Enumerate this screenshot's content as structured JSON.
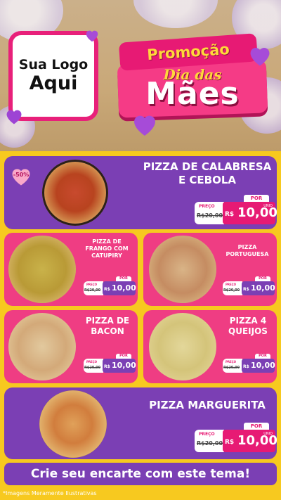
{
  "logo": {
    "line1": "Sua Logo",
    "line2": "Aqui"
  },
  "banner": {
    "line1": "Promoção",
    "line2": "Dia das",
    "line3": "Mães"
  },
  "badge": "-50%",
  "labels": {
    "price": "PREÇO",
    "por": "POR",
    "unit": "UNID"
  },
  "products": [
    {
      "name_lines": [
        "PIZZA DE CALABRESA",
        "E CEBOLA"
      ],
      "old_price": "R$20,00",
      "currency": "R$",
      "price": "10,00"
    },
    {
      "name_lines": [
        "PIZZA DE",
        "FRANGO COM",
        "CATUPIRY"
      ],
      "old_price": "R$20,00",
      "currency": "R$",
      "price": "10,00"
    },
    {
      "name_lines": [
        "PIZZA",
        "PORTUGUESA"
      ],
      "old_price": "R$20,00",
      "currency": "R$",
      "price": "10,00"
    },
    {
      "name_lines": [
        "PIZZA DE",
        "BACON"
      ],
      "old_price": "R$20,00",
      "currency": "R$",
      "price": "10,00"
    },
    {
      "name_lines": [
        "PIZZA 4",
        "QUEIJOS"
      ],
      "old_price": "R$20,00",
      "currency": "R$",
      "price": "10,00"
    },
    {
      "name_lines": [
        "PIZZA MARGUERITA"
      ],
      "old_price": "R$20,00",
      "currency": "R$",
      "price": "10,00"
    }
  ],
  "cta": "Crie seu encarte com este tema!",
  "footnote": "*Imagens Meramente Ilustrativas",
  "colors": {
    "pink": "#ef3d83",
    "purple": "#7b3fb4",
    "yellow": "#f7c91f",
    "magenta": "#e71a74"
  }
}
